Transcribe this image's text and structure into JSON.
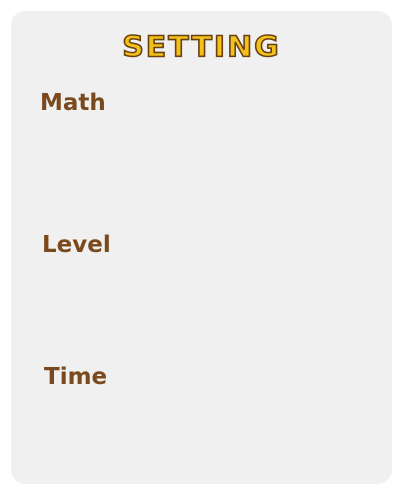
{
  "settings": {
    "title": "SETTING",
    "sections": [
      {
        "label": "Math"
      },
      {
        "label": "Level"
      },
      {
        "label": "Time"
      }
    ]
  },
  "colors": {
    "panel": "#f1f0f1",
    "title_fill": "#f2c21a",
    "title_outline": "#6a3f12",
    "label": "#7a4a1e"
  }
}
